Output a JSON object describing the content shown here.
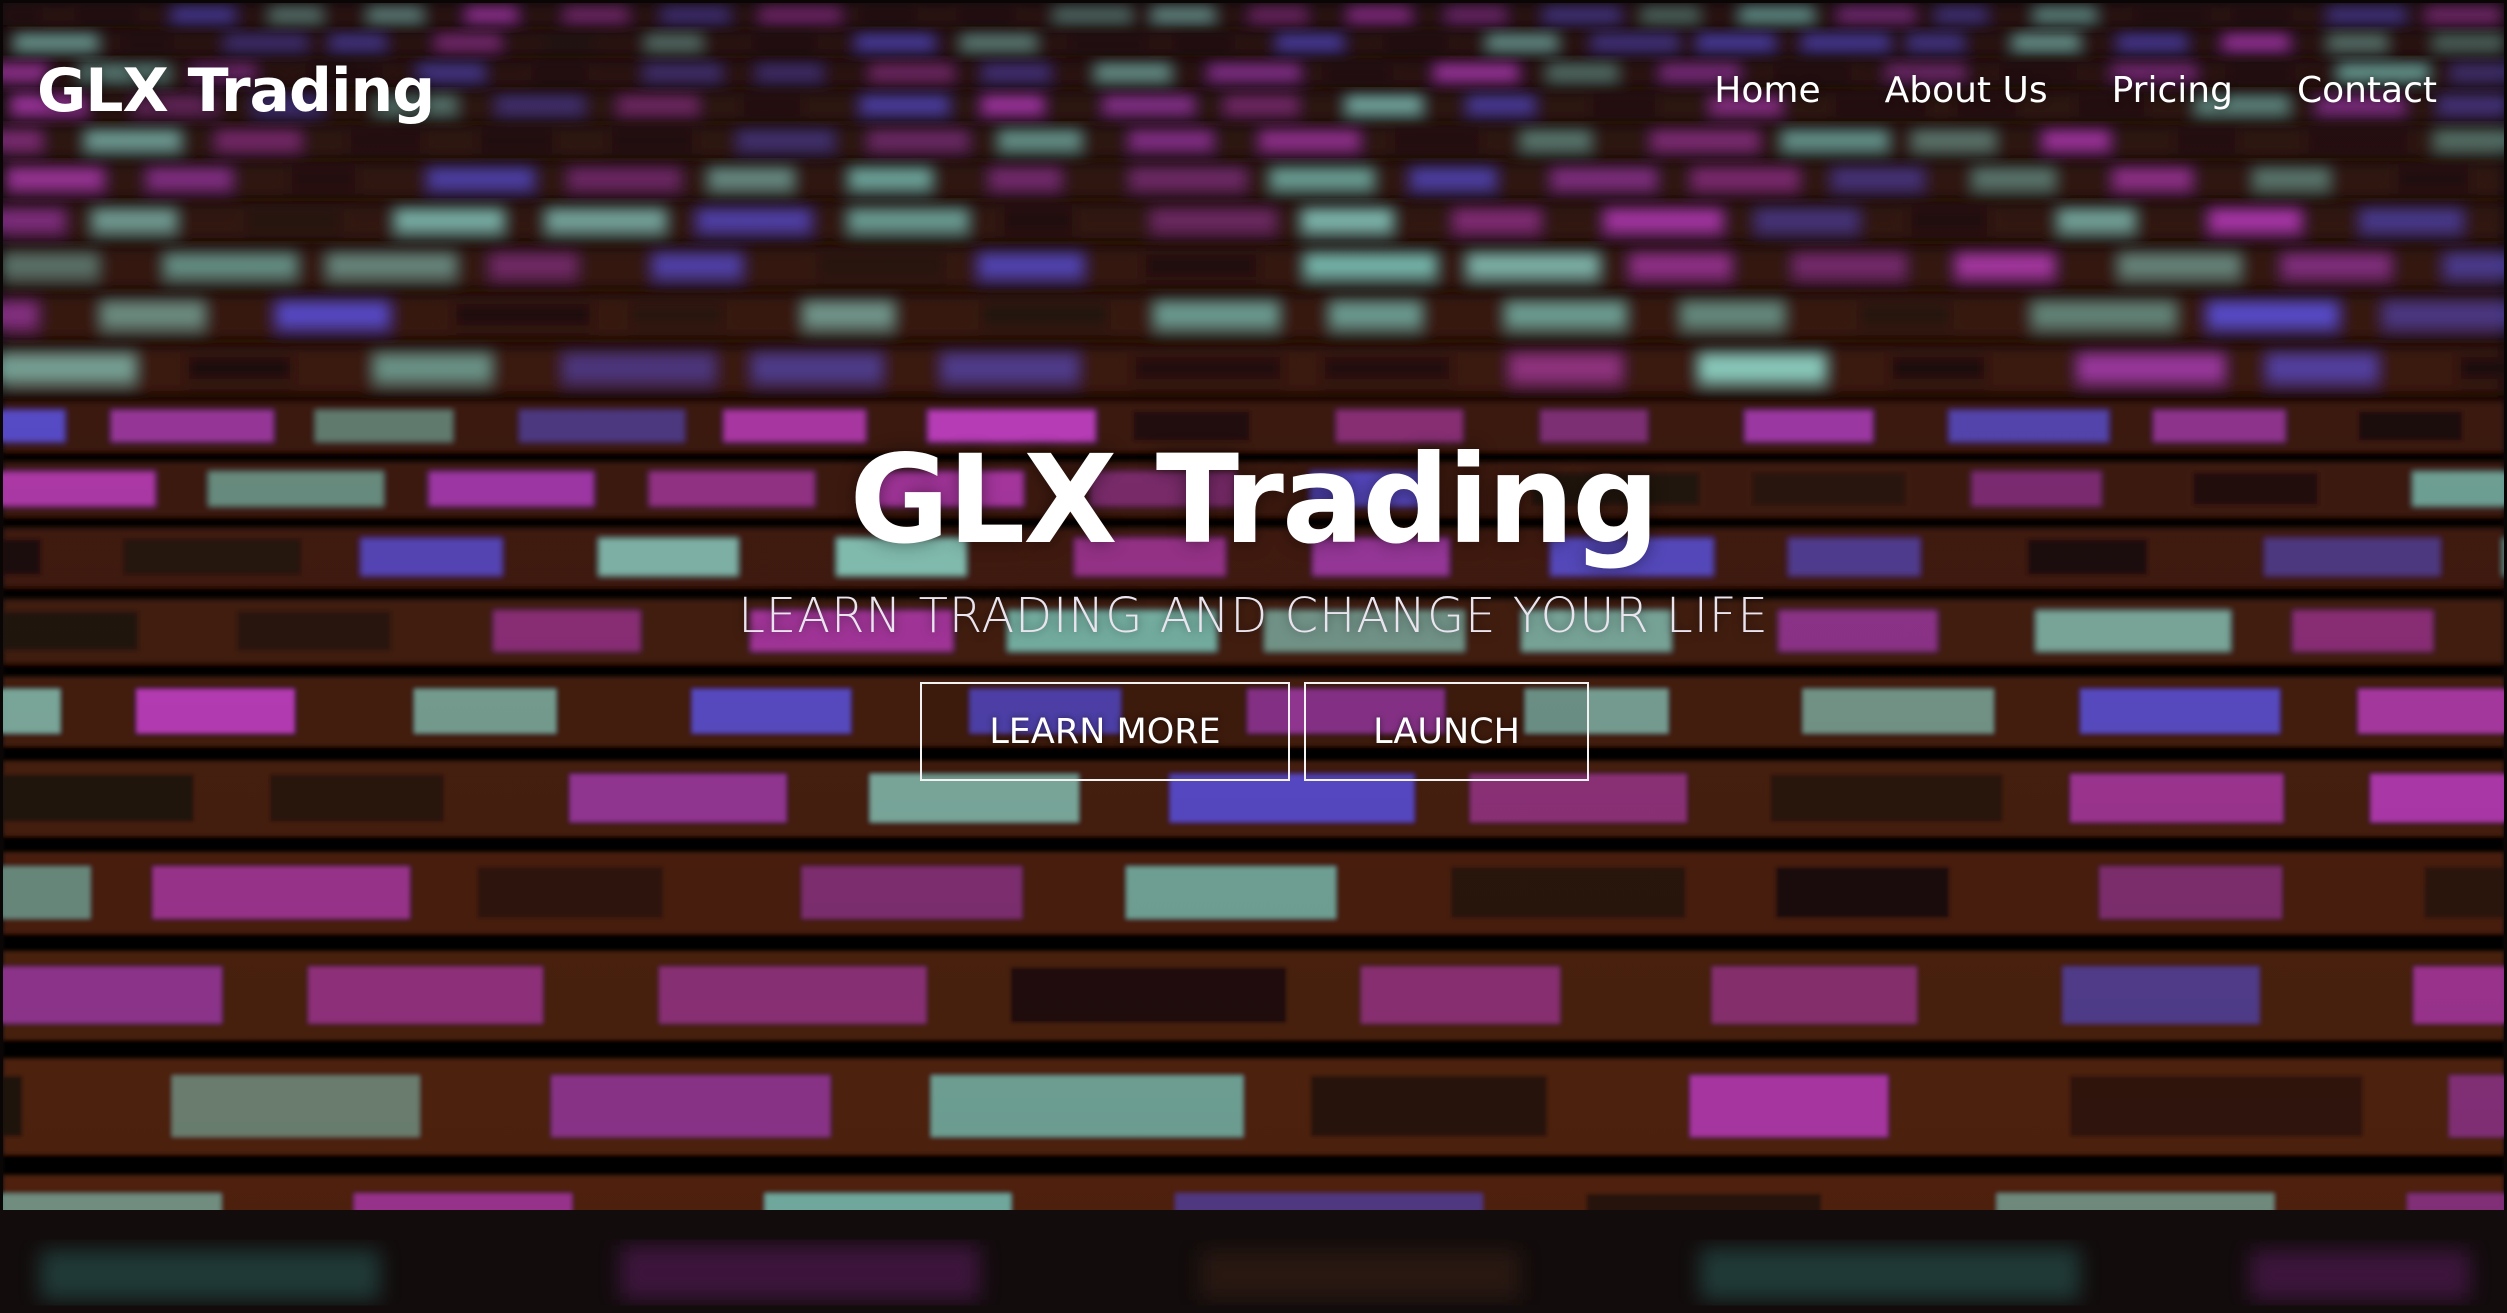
{
  "header": {
    "logo_text": "GLX Trading",
    "nav": [
      {
        "label": "Home"
      },
      {
        "label": "About Us"
      },
      {
        "label": "Pricing"
      },
      {
        "label": "Contact"
      }
    ]
  },
  "hero": {
    "title": "GLX Trading",
    "subtitle": "LEARN TRADING AND CHANGE YOUR LIFE",
    "buttons": {
      "learn_more": "LEARN MORE",
      "launch": "LAUNCH"
    },
    "background": "stock-ticker-board-image"
  },
  "colors": {
    "text": "#ffffff",
    "ticker_magenta": "#c43fc8",
    "ticker_teal": "#7fc9bd",
    "ticker_blue": "#5a4fd6",
    "grid_copper": "#8a3c1a"
  }
}
